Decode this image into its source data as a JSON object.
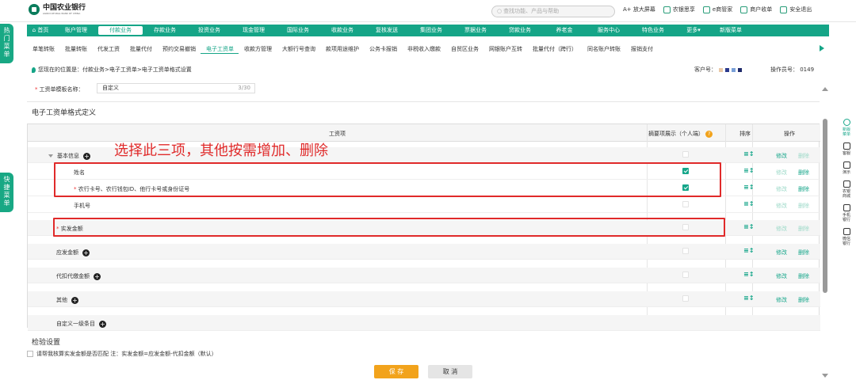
{
  "header": {
    "bank_name": "中国农业银行",
    "bank_en": "AGRICULTURAL BANK OF CHINA",
    "search_placeholder": "查找功能、产品与帮助",
    "links": [
      "A+ 放大屏幕",
      "农银思享",
      "e商管家",
      "商户收单",
      "安全退出"
    ]
  },
  "nav": {
    "items": [
      "首页",
      "账户管理",
      "付款业务",
      "存款业务",
      "投资业务",
      "现金管理",
      "国际业务",
      "收款业务",
      "复核发送",
      "集团业务",
      "票据业务",
      "贷款业务",
      "养老金",
      "服务中心",
      "特色业务",
      "更多▾",
      "新版菜单"
    ],
    "active_index": 2
  },
  "subnav": {
    "items": [
      "单笔转账",
      "批量转账",
      "代发工资",
      "批量代付",
      "预约交易撤销",
      "电子工资单",
      "收款方管理",
      "大额行号查询",
      "款项用途维护",
      "公务卡报销",
      "非税收入缴款",
      "自贸区业务",
      "网银账户互转",
      "批量代付（跨行）",
      "同名账户转账",
      "报销支付"
    ],
    "active_index": 5
  },
  "breadcrumb": "您现在的位置是：付款业务>电子工资单>电子工资单格式设置",
  "customer_label": "客户号：",
  "operator_label": "操作员号： 0149",
  "template": {
    "label": "工资单模板名称：",
    "value": "自定义",
    "count": "3/30"
  },
  "section_title": "电子工资单格式定义",
  "table": {
    "headers": {
      "item": "工资项",
      "summary": "摘要项展示（个人端）",
      "sort": "排序",
      "ops": "操作"
    },
    "rows": [
      {
        "label": "基本信息",
        "type": "group",
        "checked": null,
        "ops": false
      },
      {
        "label": "姓名",
        "type": "sub",
        "checked": true,
        "ops": true,
        "edit_disabled": true
      },
      {
        "label": "农行卡号、农行钱包ID、他行卡号或身份证号",
        "type": "sub",
        "req": true,
        "checked": true,
        "ops": true,
        "edit_disabled": true
      },
      {
        "label": "手机号",
        "type": "sub",
        "checked": false,
        "ops": false
      },
      {
        "label": "实发金额",
        "type": "group",
        "req": true,
        "checked": false,
        "ops": false
      },
      {
        "label": "应发金额",
        "type": "group",
        "plus": true,
        "checked": false,
        "ops": true
      },
      {
        "label": "代扣代缴金额",
        "type": "group",
        "plus": true,
        "checked": false,
        "ops": true
      },
      {
        "label": "其他",
        "type": "group",
        "plus": true,
        "checked": false,
        "ops": true
      },
      {
        "label": "自定义一级条目",
        "type": "addrow",
        "plus": true
      }
    ],
    "edit": "修改",
    "delete": "删除"
  },
  "annotation": "选择此三项，其他按需增加、删除",
  "check": {
    "title": "检验设置",
    "text": "请帮我核算实发金额是否匹配 注：实发金额=应发金额-代扣金额（默认）"
  },
  "buttons": {
    "save": "保 存",
    "cancel": "取 消"
  },
  "left_tabs": [
    "热门菜单",
    "快捷菜单"
  ],
  "right_side": [
    "新版菜单",
    "客服",
    "演示",
    "农银商城",
    "手机银行",
    "微信银行"
  ],
  "colors": {
    "brand": "#15a587",
    "annot": "#e02a2a",
    "save": "#f2a31c"
  }
}
